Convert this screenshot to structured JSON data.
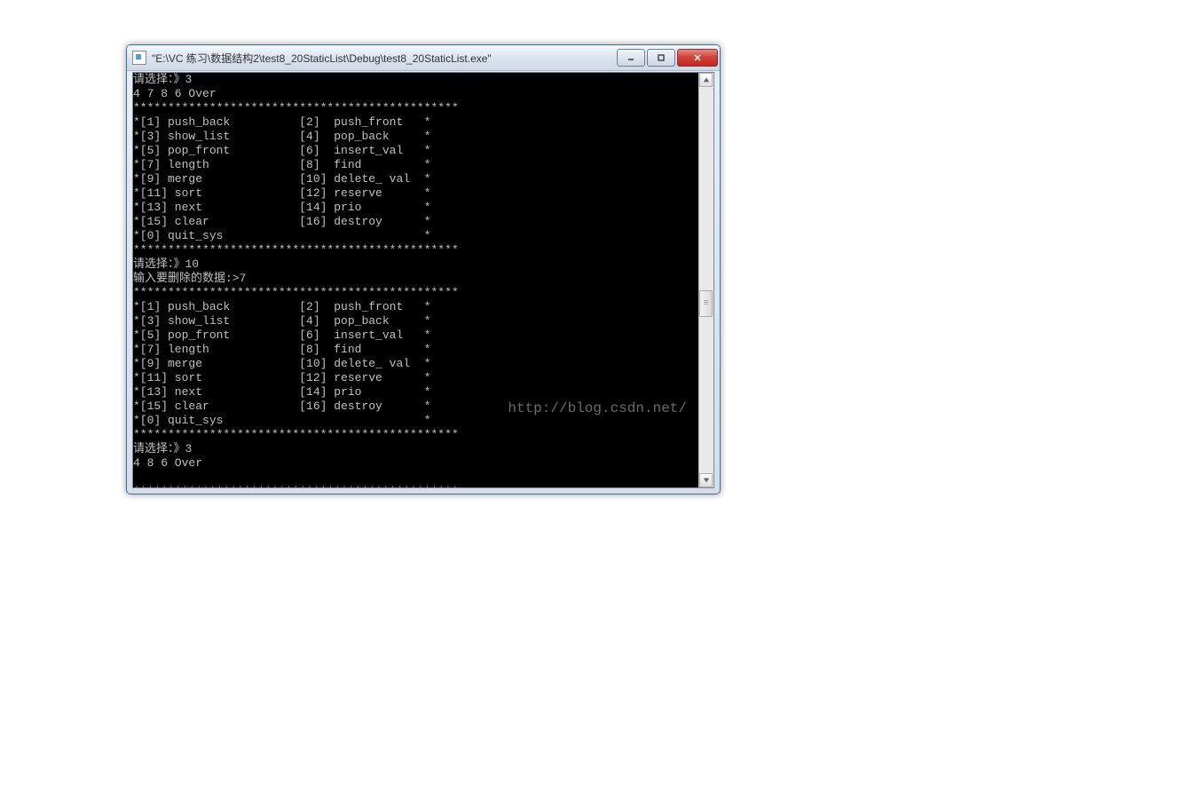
{
  "window": {
    "title": "\"E:\\VC 练习\\数据结构2\\test8_20StaticList\\Debug\\test8_20StaticList.exe\""
  },
  "watermark": "http://blog.csdn.net/",
  "console": {
    "lines": [
      "请选择：》3",
      "4 7 8 6 Over",
      "***********************************************",
      "*[1] push_back          [2]  push_front   *",
      "*[3] show_list          [4]  pop_back     *",
      "*[5] pop_front          [6]  insert_val   *",
      "*[7] length             [8]  find         *",
      "*[9] merge              [10] delete_ val  *",
      "*[11] sort              [12] reserve      *",
      "*[13] next              [14] prio         *",
      "*[15] clear             [16] destroy      *",
      "*[0] quit_sys                             *",
      "***********************************************",
      "请选择：》10",
      "输入要删除的数据:>7",
      "***********************************************",
      "*[1] push_back          [2]  push_front   *",
      "*[3] show_list          [4]  pop_back     *",
      "*[5] pop_front          [6]  insert_val   *",
      "*[7] length             [8]  find         *",
      "*[9] merge              [10] delete_ val  *",
      "*[11] sort              [12] reserve      *",
      "*[13] next              [14] prio         *",
      "*[15] clear             [16] destroy      *",
      "*[0] quit_sys                             *",
      "***********************************************",
      "请选择：》3",
      "4 8 6 Over",
      "",
      "***********************************************"
    ]
  }
}
